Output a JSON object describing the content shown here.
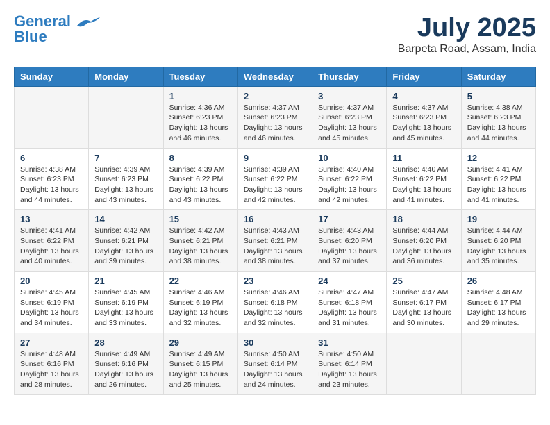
{
  "header": {
    "logo_line1": "General",
    "logo_line2": "Blue",
    "month_year": "July 2025",
    "location": "Barpeta Road, Assam, India"
  },
  "weekdays": [
    "Sunday",
    "Monday",
    "Tuesday",
    "Wednesday",
    "Thursday",
    "Friday",
    "Saturday"
  ],
  "weeks": [
    [
      {
        "day": "",
        "info": ""
      },
      {
        "day": "",
        "info": ""
      },
      {
        "day": "1",
        "info": "Sunrise: 4:36 AM\nSunset: 6:23 PM\nDaylight: 13 hours and 46 minutes."
      },
      {
        "day": "2",
        "info": "Sunrise: 4:37 AM\nSunset: 6:23 PM\nDaylight: 13 hours and 46 minutes."
      },
      {
        "day": "3",
        "info": "Sunrise: 4:37 AM\nSunset: 6:23 PM\nDaylight: 13 hours and 45 minutes."
      },
      {
        "day": "4",
        "info": "Sunrise: 4:37 AM\nSunset: 6:23 PM\nDaylight: 13 hours and 45 minutes."
      },
      {
        "day": "5",
        "info": "Sunrise: 4:38 AM\nSunset: 6:23 PM\nDaylight: 13 hours and 44 minutes."
      }
    ],
    [
      {
        "day": "6",
        "info": "Sunrise: 4:38 AM\nSunset: 6:23 PM\nDaylight: 13 hours and 44 minutes."
      },
      {
        "day": "7",
        "info": "Sunrise: 4:39 AM\nSunset: 6:23 PM\nDaylight: 13 hours and 43 minutes."
      },
      {
        "day": "8",
        "info": "Sunrise: 4:39 AM\nSunset: 6:22 PM\nDaylight: 13 hours and 43 minutes."
      },
      {
        "day": "9",
        "info": "Sunrise: 4:39 AM\nSunset: 6:22 PM\nDaylight: 13 hours and 42 minutes."
      },
      {
        "day": "10",
        "info": "Sunrise: 4:40 AM\nSunset: 6:22 PM\nDaylight: 13 hours and 42 minutes."
      },
      {
        "day": "11",
        "info": "Sunrise: 4:40 AM\nSunset: 6:22 PM\nDaylight: 13 hours and 41 minutes."
      },
      {
        "day": "12",
        "info": "Sunrise: 4:41 AM\nSunset: 6:22 PM\nDaylight: 13 hours and 41 minutes."
      }
    ],
    [
      {
        "day": "13",
        "info": "Sunrise: 4:41 AM\nSunset: 6:22 PM\nDaylight: 13 hours and 40 minutes."
      },
      {
        "day": "14",
        "info": "Sunrise: 4:42 AM\nSunset: 6:21 PM\nDaylight: 13 hours and 39 minutes."
      },
      {
        "day": "15",
        "info": "Sunrise: 4:42 AM\nSunset: 6:21 PM\nDaylight: 13 hours and 38 minutes."
      },
      {
        "day": "16",
        "info": "Sunrise: 4:43 AM\nSunset: 6:21 PM\nDaylight: 13 hours and 38 minutes."
      },
      {
        "day": "17",
        "info": "Sunrise: 4:43 AM\nSunset: 6:20 PM\nDaylight: 13 hours and 37 minutes."
      },
      {
        "day": "18",
        "info": "Sunrise: 4:44 AM\nSunset: 6:20 PM\nDaylight: 13 hours and 36 minutes."
      },
      {
        "day": "19",
        "info": "Sunrise: 4:44 AM\nSunset: 6:20 PM\nDaylight: 13 hours and 35 minutes."
      }
    ],
    [
      {
        "day": "20",
        "info": "Sunrise: 4:45 AM\nSunset: 6:19 PM\nDaylight: 13 hours and 34 minutes."
      },
      {
        "day": "21",
        "info": "Sunrise: 4:45 AM\nSunset: 6:19 PM\nDaylight: 13 hours and 33 minutes."
      },
      {
        "day": "22",
        "info": "Sunrise: 4:46 AM\nSunset: 6:19 PM\nDaylight: 13 hours and 32 minutes."
      },
      {
        "day": "23",
        "info": "Sunrise: 4:46 AM\nSunset: 6:18 PM\nDaylight: 13 hours and 32 minutes."
      },
      {
        "day": "24",
        "info": "Sunrise: 4:47 AM\nSunset: 6:18 PM\nDaylight: 13 hours and 31 minutes."
      },
      {
        "day": "25",
        "info": "Sunrise: 4:47 AM\nSunset: 6:17 PM\nDaylight: 13 hours and 30 minutes."
      },
      {
        "day": "26",
        "info": "Sunrise: 4:48 AM\nSunset: 6:17 PM\nDaylight: 13 hours and 29 minutes."
      }
    ],
    [
      {
        "day": "27",
        "info": "Sunrise: 4:48 AM\nSunset: 6:16 PM\nDaylight: 13 hours and 28 minutes."
      },
      {
        "day": "28",
        "info": "Sunrise: 4:49 AM\nSunset: 6:16 PM\nDaylight: 13 hours and 26 minutes."
      },
      {
        "day": "29",
        "info": "Sunrise: 4:49 AM\nSunset: 6:15 PM\nDaylight: 13 hours and 25 minutes."
      },
      {
        "day": "30",
        "info": "Sunrise: 4:50 AM\nSunset: 6:14 PM\nDaylight: 13 hours and 24 minutes."
      },
      {
        "day": "31",
        "info": "Sunrise: 4:50 AM\nSunset: 6:14 PM\nDaylight: 13 hours and 23 minutes."
      },
      {
        "day": "",
        "info": ""
      },
      {
        "day": "",
        "info": ""
      }
    ]
  ]
}
